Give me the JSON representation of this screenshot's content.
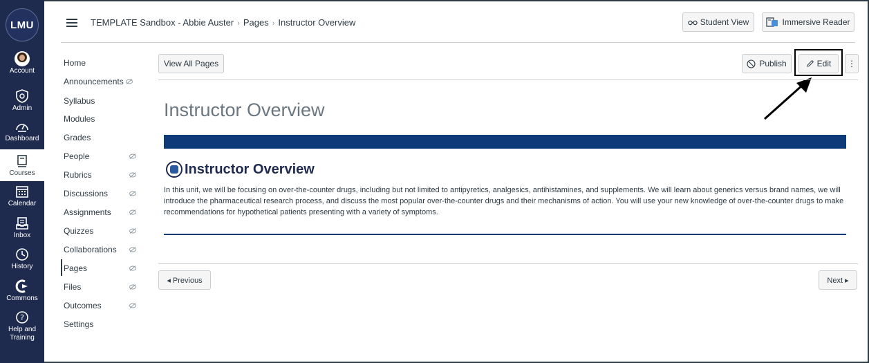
{
  "global_nav": {
    "logo_text": "LMU",
    "items": [
      {
        "label": "Account",
        "icon": "avatar"
      },
      {
        "label": "Admin",
        "icon": "shield-icon"
      },
      {
        "label": "Dashboard",
        "icon": "dashboard-icon"
      },
      {
        "label": "Courses",
        "icon": "book-icon"
      },
      {
        "label": "Calendar",
        "icon": "calendar-icon"
      },
      {
        "label": "Inbox",
        "icon": "inbox-icon"
      },
      {
        "label": "History",
        "icon": "clock-icon"
      },
      {
        "label": "Commons",
        "icon": "commons-icon"
      },
      {
        "label": "Help and Training",
        "icon": "help-icon"
      }
    ],
    "active": "Courses",
    "bg_color": "#1f2b4e"
  },
  "breadcrumb": {
    "course": "TEMPLATE Sandbox - Abbie Auster",
    "section": "Pages",
    "page": "Instructor Overview"
  },
  "header_buttons": {
    "student_view": "Student View",
    "immersive_reader": "Immersive Reader"
  },
  "course_nav": [
    {
      "label": "Home",
      "hidden": false
    },
    {
      "label": "Announcements",
      "hidden": true
    },
    {
      "label": "Syllabus",
      "hidden": false
    },
    {
      "label": "Modules",
      "hidden": false
    },
    {
      "label": "Grades",
      "hidden": false
    },
    {
      "label": "People",
      "hidden": true
    },
    {
      "label": "Rubrics",
      "hidden": true
    },
    {
      "label": "Discussions",
      "hidden": true
    },
    {
      "label": "Assignments",
      "hidden": true
    },
    {
      "label": "Quizzes",
      "hidden": true
    },
    {
      "label": "Collaborations",
      "hidden": true
    },
    {
      "label": "Pages",
      "hidden": true,
      "active": true
    },
    {
      "label": "Files",
      "hidden": true
    },
    {
      "label": "Outcomes",
      "hidden": true
    },
    {
      "label": "Settings",
      "hidden": false
    }
  ],
  "toolbar": {
    "view_all_pages": "View All Pages",
    "publish": "Publish",
    "edit": "Edit",
    "more": "⋮"
  },
  "page": {
    "title": "Instructor Overview",
    "heading": "Instructor Overview",
    "body": "In this unit, we will be focusing on over-the-counter drugs, including but not limited to antipyretics, analgesics, antihistamines, and supplements. We will learn about generics versus brand names, we will introduce the pharmaceutical research process, and discuss the most popular over-the-counter drugs and their mechanisms of action. You will use your new knowledge of over-the-counter drugs to make recommendations for hypothetical patients presenting with a variety of symptoms.",
    "banner_color": "#0e3a79"
  },
  "pagination": {
    "previous": "◂ Previous",
    "next": "Next ▸"
  }
}
